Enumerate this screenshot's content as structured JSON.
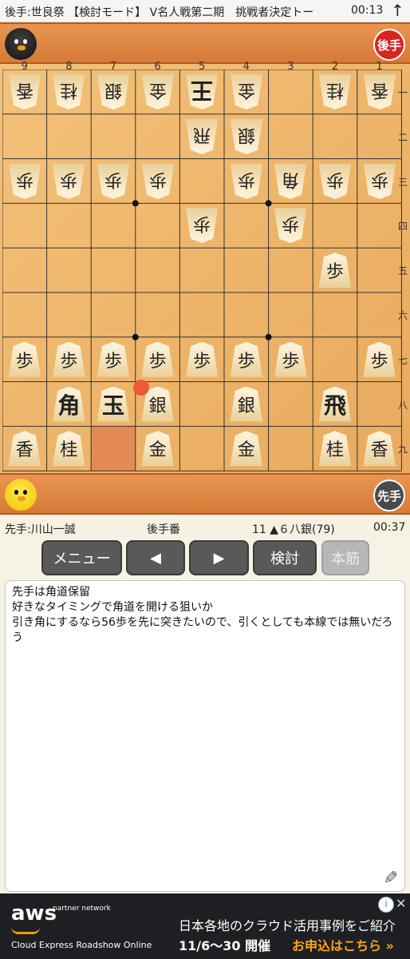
{
  "header": {
    "title": "後手:世良祭 【検討モード】 V名人戦第二期　挑戦者決定トー",
    "clock": "00:13",
    "up_icon": "↑"
  },
  "gote": {
    "badge": "後手"
  },
  "sente": {
    "badge": "先手"
  },
  "board": {
    "col_labels": [
      "9",
      "8",
      "7",
      "6",
      "5",
      "4",
      "3",
      "2",
      "1"
    ],
    "row_labels": [
      "一",
      "二",
      "三",
      "四",
      "五",
      "六",
      "七",
      "八",
      "九"
    ],
    "highlight": {
      "file": 7,
      "rank": 9
    },
    "last_move_dot": {
      "file": 6,
      "rank": 8
    },
    "pieces": [
      {
        "file": 9,
        "rank": 1,
        "label": "香",
        "side": "gote"
      },
      {
        "file": 8,
        "rank": 1,
        "label": "桂",
        "side": "gote"
      },
      {
        "file": 7,
        "rank": 1,
        "label": "銀",
        "side": "gote"
      },
      {
        "file": 6,
        "rank": 1,
        "label": "金",
        "side": "gote"
      },
      {
        "file": 5,
        "rank": 1,
        "label": "王",
        "side": "gote",
        "big": true
      },
      {
        "file": 4,
        "rank": 1,
        "label": "金",
        "side": "gote"
      },
      {
        "file": 2,
        "rank": 1,
        "label": "桂",
        "side": "gote"
      },
      {
        "file": 1,
        "rank": 1,
        "label": "香",
        "side": "gote"
      },
      {
        "file": 5,
        "rank": 2,
        "label": "飛",
        "side": "gote"
      },
      {
        "file": 4,
        "rank": 2,
        "label": "銀",
        "side": "gote"
      },
      {
        "file": 9,
        "rank": 3,
        "label": "歩",
        "side": "gote"
      },
      {
        "file": 8,
        "rank": 3,
        "label": "歩",
        "side": "gote"
      },
      {
        "file": 7,
        "rank": 3,
        "label": "歩",
        "side": "gote"
      },
      {
        "file": 6,
        "rank": 3,
        "label": "歩",
        "side": "gote"
      },
      {
        "file": 4,
        "rank": 3,
        "label": "歩",
        "side": "gote"
      },
      {
        "file": 3,
        "rank": 3,
        "label": "角",
        "side": "gote"
      },
      {
        "file": 2,
        "rank": 3,
        "label": "歩",
        "side": "gote"
      },
      {
        "file": 1,
        "rank": 3,
        "label": "歩",
        "side": "gote"
      },
      {
        "file": 5,
        "rank": 4,
        "label": "歩",
        "side": "gote"
      },
      {
        "file": 3,
        "rank": 4,
        "label": "歩",
        "side": "gote"
      },
      {
        "file": 2,
        "rank": 5,
        "label": "歩",
        "side": "sente"
      },
      {
        "file": 9,
        "rank": 7,
        "label": "歩",
        "side": "sente"
      },
      {
        "file": 8,
        "rank": 7,
        "label": "歩",
        "side": "sente"
      },
      {
        "file": 7,
        "rank": 7,
        "label": "歩",
        "side": "sente"
      },
      {
        "file": 6,
        "rank": 7,
        "label": "歩",
        "side": "sente"
      },
      {
        "file": 5,
        "rank": 7,
        "label": "歩",
        "side": "sente"
      },
      {
        "file": 4,
        "rank": 7,
        "label": "歩",
        "side": "sente"
      },
      {
        "file": 3,
        "rank": 7,
        "label": "歩",
        "side": "sente"
      },
      {
        "file": 1,
        "rank": 7,
        "label": "歩",
        "side": "sente"
      },
      {
        "file": 8,
        "rank": 8,
        "label": "角",
        "side": "sente",
        "big": true
      },
      {
        "file": 7,
        "rank": 8,
        "label": "玉",
        "side": "sente",
        "big": true
      },
      {
        "file": 6,
        "rank": 8,
        "label": "銀",
        "side": "sente"
      },
      {
        "file": 4,
        "rank": 8,
        "label": "銀",
        "side": "sente"
      },
      {
        "file": 2,
        "rank": 8,
        "label": "飛",
        "side": "sente",
        "big": true
      },
      {
        "file": 9,
        "rank": 9,
        "label": "香",
        "side": "sente"
      },
      {
        "file": 8,
        "rank": 9,
        "label": "桂",
        "side": "sente"
      },
      {
        "file": 6,
        "rank": 9,
        "label": "金",
        "side": "sente"
      },
      {
        "file": 4,
        "rank": 9,
        "label": "金",
        "side": "sente"
      },
      {
        "file": 2,
        "rank": 9,
        "label": "桂",
        "side": "sente"
      },
      {
        "file": 1,
        "rank": 9,
        "label": "香",
        "side": "sente"
      }
    ]
  },
  "info": {
    "sente_player": "先手:川山一誠",
    "turn": "後手番",
    "move": "11 ▲６八銀(79)",
    "clock": "00:37"
  },
  "buttons": {
    "menu": "メニュー",
    "prev": "◀",
    "next": "▶",
    "analyze": "検討",
    "mainline": "本筋"
  },
  "comment": {
    "lines": [
      "先手は角道保留",
      "好きなタイミングで角道を開ける狙いか",
      "引き角にするなら56歩を先に突きたいので、引くとしても本線では無いだろう"
    ],
    "edit_icon": "✎"
  },
  "ad": {
    "brand": "aws",
    "partner": "partner network",
    "roadshow": "Cloud Express Roadshow Online",
    "title": "日本各地のクラウド活用事例をご紹介",
    "dates": "11/6〜30 開催",
    "cta": "お申込はこちら »",
    "info_icon": "i",
    "close_icon": "✕"
  }
}
